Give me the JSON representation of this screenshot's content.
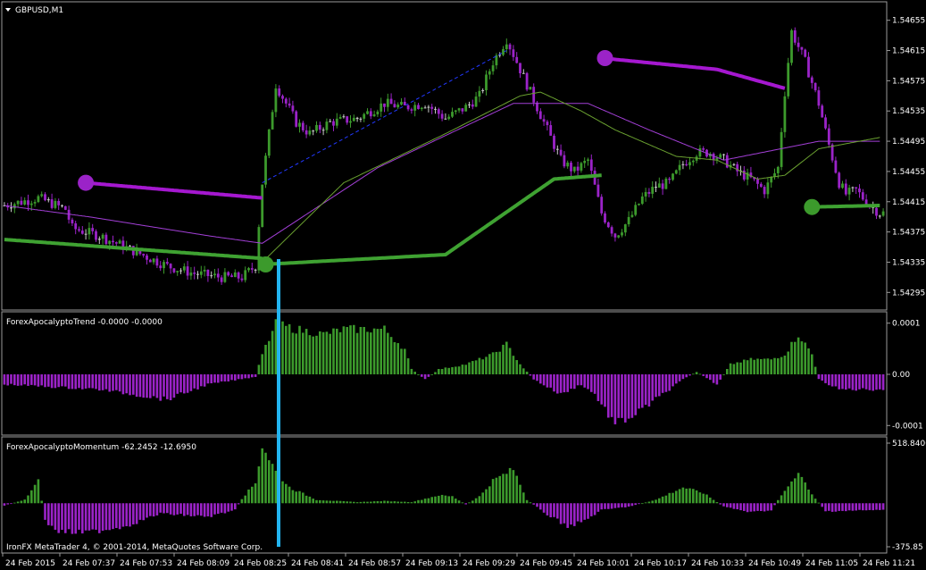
{
  "window": {
    "title": "GBPUSD,M1"
  },
  "footer": {
    "copyright": "IronFX MetaTrader 4, © 2001-2014, MetaQuotes Software Corp."
  },
  "colors": {
    "bull": "#3c9a2c",
    "bear": "#9b23c8",
    "doji": "#c8c8c8",
    "selection_line": "#22b4f0",
    "slow_ma": "#a23fd6",
    "fast_ma": "#6aa030",
    "trail_up": "#3fa232",
    "trail_down": "#a518d0",
    "trend_line": "#2238ff"
  },
  "chart_data": [
    {
      "type": "candlestick",
      "title": "GBPUSD,M1",
      "ylim": [
        1.5428,
        1.5467
      ],
      "y_ticks": [
        "1.54655",
        "1.54615",
        "1.54575",
        "1.54535",
        "1.54495",
        "1.54455",
        "1.54415",
        "1.54375",
        "1.54335",
        "1.54295"
      ],
      "x_labels": [
        "24 Feb 2015",
        "24 Feb 07:37",
        "24 Feb 07:53",
        "24 Feb 08:09",
        "24 Feb 08:25",
        "24 Feb 08:41",
        "24 Feb 08:57",
        "24 Feb 09:13",
        "24 Feb 09:29",
        "24 Feb 09:45",
        "24 Feb 10:01",
        "24 Feb 10:17",
        "24 Feb 10:33",
        "24 Feb 10:49",
        "24 Feb 11:05",
        "24 Feb 11:21"
      ],
      "close_path": [
        [
          0,
          1.5441
        ],
        [
          10,
          1.5442
        ],
        [
          18,
          1.54405
        ],
        [
          20,
          1.5438
        ],
        [
          28,
          1.5437
        ],
        [
          38,
          1.5435
        ],
        [
          48,
          1.5433
        ],
        [
          56,
          1.5432
        ],
        [
          64,
          1.54315
        ],
        [
          70,
          1.54315
        ],
        [
          74,
          1.5433
        ],
        [
          76,
          1.5444
        ],
        [
          80,
          1.5457
        ],
        [
          86,
          1.5452
        ],
        [
          90,
          1.54505
        ],
        [
          96,
          1.5452
        ],
        [
          104,
          1.54525
        ],
        [
          112,
          1.54545
        ],
        [
          118,
          1.5454
        ],
        [
          124,
          1.54545
        ],
        [
          130,
          1.54525
        ],
        [
          136,
          1.5454
        ],
        [
          140,
          1.54555
        ],
        [
          144,
          1.546
        ],
        [
          148,
          1.5463
        ],
        [
          152,
          1.5459
        ],
        [
          156,
          1.5455
        ],
        [
          160,
          1.5451
        ],
        [
          164,
          1.5447
        ],
        [
          168,
          1.54455
        ],
        [
          172,
          1.5447
        ],
        [
          176,
          1.544
        ],
        [
          180,
          1.5437
        ],
        [
          184,
          1.5439
        ],
        [
          188,
          1.5442
        ],
        [
          192,
          1.54435
        ],
        [
          196,
          1.5444
        ],
        [
          200,
          1.54465
        ],
        [
          204,
          1.5448
        ],
        [
          208,
          1.5448
        ],
        [
          212,
          1.5447
        ],
        [
          216,
          1.54455
        ],
        [
          220,
          1.54445
        ],
        [
          224,
          1.5443
        ],
        [
          228,
          1.5446
        ],
        [
          230,
          1.5456
        ],
        [
          232,
          1.5464
        ],
        [
          236,
          1.546
        ],
        [
          240,
          1.54545
        ],
        [
          243,
          1.5449
        ],
        [
          246,
          1.5444
        ],
        [
          248,
          1.54425
        ],
        [
          251,
          1.5443
        ],
        [
          255,
          1.5441
        ],
        [
          258,
          1.544
        ]
      ],
      "fast_ma_path": [
        [
          76,
          1.54335
        ],
        [
          100,
          1.5444
        ],
        [
          130,
          1.54505
        ],
        [
          152,
          1.54555
        ],
        [
          158,
          1.5456
        ],
        [
          170,
          1.54535
        ],
        [
          180,
          1.5451
        ],
        [
          198,
          1.54475
        ],
        [
          210,
          1.5447
        ],
        [
          222,
          1.54445
        ],
        [
          230,
          1.5445
        ],
        [
          240,
          1.54485
        ],
        [
          258,
          1.545
        ]
      ],
      "slow_ma_path": [
        [
          0,
          1.5441
        ],
        [
          25,
          1.54395
        ],
        [
          60,
          1.5437
        ],
        [
          76,
          1.5436
        ],
        [
          110,
          1.5446
        ],
        [
          150,
          1.54545
        ],
        [
          172,
          1.54545
        ],
        [
          190,
          1.5451
        ],
        [
          212,
          1.5447
        ],
        [
          240,
          1.54495
        ],
        [
          258,
          1.54495
        ]
      ],
      "trailing_up": [
        [
          [
            0,
            1.54365
          ],
          [
            76,
            1.5434
          ]
        ],
        [
          [
            76,
            1.54332
          ],
          [
            130,
            1.54345
          ],
          [
            146,
            1.54395
          ],
          [
            162,
            1.54445
          ],
          [
            176,
            1.5445
          ]
        ],
        [
          [
            238,
            1.54408
          ],
          [
            258,
            1.5441
          ]
        ]
      ],
      "trailing_down": [
        [
          [
            24,
            1.5444
          ],
          [
            76,
            1.5442
          ]
        ],
        [
          [
            176,
            1.54605
          ],
          [
            210,
            1.5459
          ],
          [
            230,
            1.54565
          ]
        ]
      ],
      "trend_line": [
        [
          76,
          1.5444
        ],
        [
          148,
          1.54615
        ]
      ],
      "markers": [
        {
          "color": "bear",
          "at": [
            24,
            1.5444
          ]
        },
        {
          "color": "bull",
          "at": [
            77,
            1.54332
          ]
        },
        {
          "color": "bear",
          "at": [
            177,
            1.54605
          ]
        },
        {
          "color": "bull",
          "at": [
            238,
            1.54408
          ]
        }
      ]
    },
    {
      "type": "histogram",
      "title": "ForexApocalyptoTrend -0.0000 -0.0000",
      "ylim": [
        -0.00011,
        0.00011
      ],
      "y_ticks": [
        "0.0001",
        "0.00",
        "-0.0001"
      ],
      "path": [
        [
          0,
          -2e-05
        ],
        [
          28,
          -3e-05
        ],
        [
          48,
          -5e-05
        ],
        [
          60,
          -2e-05
        ],
        [
          74,
          -5e-06
        ],
        [
          76,
          4e-05
        ],
        [
          80,
          0.0001
        ],
        [
          86,
          9e-05
        ],
        [
          94,
          8e-05
        ],
        [
          100,
          9e-05
        ],
        [
          112,
          9e-05
        ],
        [
          118,
          5e-05
        ],
        [
          120,
          1e-05
        ],
        [
          124,
          -1e-05
        ],
        [
          128,
          1e-05
        ],
        [
          136,
          2e-05
        ],
        [
          144,
          4e-05
        ],
        [
          148,
          6e-05
        ],
        [
          152,
          2e-05
        ],
        [
          156,
          -1e-05
        ],
        [
          164,
          -4e-05
        ],
        [
          170,
          -2e-05
        ],
        [
          174,
          -4e-05
        ],
        [
          180,
          -0.0001
        ],
        [
          186,
          -8e-05
        ],
        [
          192,
          -5e-05
        ],
        [
          200,
          -1e-05
        ],
        [
          204,
          5e-06
        ],
        [
          210,
          -2e-05
        ],
        [
          214,
          2e-05
        ],
        [
          220,
          3e-05
        ],
        [
          226,
          3e-05
        ],
        [
          230,
          4e-05
        ],
        [
          234,
          8e-05
        ],
        [
          238,
          4e-05
        ],
        [
          240,
          -1e-05
        ],
        [
          246,
          -3e-05
        ],
        [
          258,
          -3e-05
        ]
      ]
    },
    {
      "type": "histogram",
      "title": "ForexApocalyptoMomentum -62.2452 -12.6950",
      "ylim": [
        -375.85,
        518.8406
      ],
      "y_ticks": [
        "518.8406",
        "-375.85"
      ],
      "path": [
        [
          0,
          -20
        ],
        [
          6,
          30
        ],
        [
          10,
          200
        ],
        [
          12,
          -160
        ],
        [
          16,
          -250
        ],
        [
          24,
          -260
        ],
        [
          36,
          -200
        ],
        [
          46,
          -90
        ],
        [
          60,
          -120
        ],
        [
          68,
          -60
        ],
        [
          70,
          40
        ],
        [
          74,
          180
        ],
        [
          76,
          510
        ],
        [
          80,
          280
        ],
        [
          84,
          140
        ],
        [
          92,
          30
        ],
        [
          104,
          10
        ],
        [
          112,
          20
        ],
        [
          120,
          10
        ],
        [
          128,
          70
        ],
        [
          132,
          60
        ],
        [
          136,
          -10
        ],
        [
          140,
          60
        ],
        [
          144,
          200
        ],
        [
          150,
          300
        ],
        [
          154,
          30
        ],
        [
          160,
          -100
        ],
        [
          166,
          -200
        ],
        [
          170,
          -170
        ],
        [
          176,
          -60
        ],
        [
          184,
          -30
        ],
        [
          192,
          30
        ],
        [
          200,
          140
        ],
        [
          206,
          90
        ],
        [
          212,
          -30
        ],
        [
          220,
          -80
        ],
        [
          226,
          -60
        ],
        [
          230,
          110
        ],
        [
          234,
          280
        ],
        [
          238,
          80
        ],
        [
          242,
          -70
        ],
        [
          258,
          -60
        ]
      ]
    }
  ]
}
